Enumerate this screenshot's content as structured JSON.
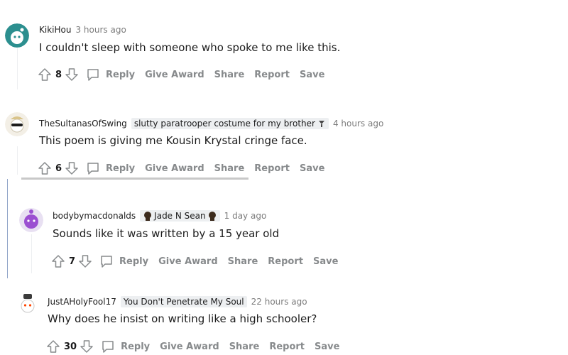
{
  "comments": [
    {
      "author": "KikiHou",
      "flair": "",
      "time": "3 hours ago",
      "body": "I couldn't sleep with someone who spoke to me like this.",
      "score": "8"
    },
    {
      "author": "TheSultanasOfSwing",
      "flair": "slutty paratrooper costume for my brother",
      "time": "4 hours ago",
      "body": "This poem is giving me Kousin Krystal cringe face.",
      "score": "6"
    },
    {
      "author": "bodybymacdonalds",
      "flair": "Jade N Sean",
      "time": "1 day ago",
      "body": "Sounds like it was written by a 15 year old",
      "score": "7"
    },
    {
      "author": "JustAHolyFool17",
      "flair": "You Don't Penetrate My Soul",
      "time": "22 hours ago",
      "body": "Why does he insist on writing like a high schooler?",
      "score": "30"
    }
  ],
  "actions": {
    "reply": "Reply",
    "give_award": "Give Award",
    "share": "Share",
    "report": "Report",
    "save": "Save"
  },
  "colors": {
    "meta_gray": "#7c7c7c",
    "action_gray": "#878a8c",
    "flair_bg": "#edeff1",
    "thread_line_blue": "#8fa3c7"
  }
}
